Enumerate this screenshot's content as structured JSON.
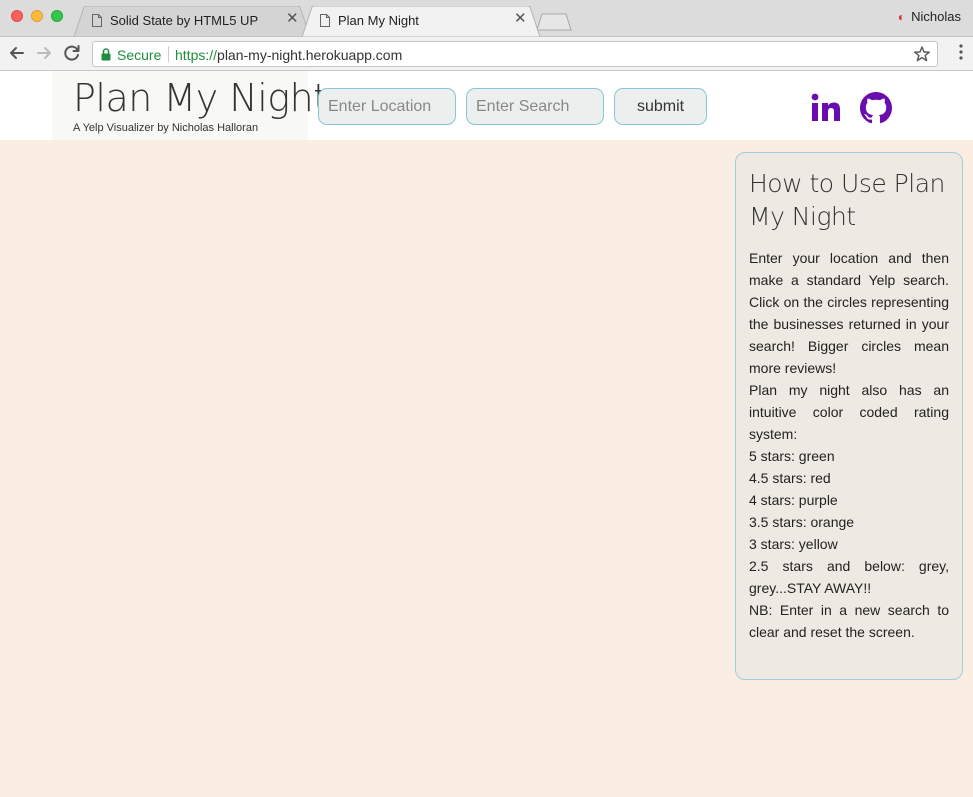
{
  "browser": {
    "tabs": [
      {
        "title": "Solid State by HTML5 UP",
        "active": false
      },
      {
        "title": "Plan My Night",
        "active": true
      }
    ],
    "profile_name": "Nicholas",
    "secure_label": "Secure",
    "url_scheme": "https://",
    "url_host": "plan-my-night.herokuapp.com"
  },
  "header": {
    "title": "Plan My Night",
    "subtitle": "A Yelp Visualizer by Nicholas Halloran",
    "location_placeholder": "Enter Location",
    "search_placeholder": "Enter Search",
    "submit_label": "submit",
    "social_icons": [
      "linkedin-icon",
      "github-icon"
    ],
    "social_color": "#6a0dad"
  },
  "info": {
    "title": "How to Use Plan My Night",
    "lines": [
      "Enter your location and then make a standard Yelp search. Click on the circles representing the businesses returned in your search! Bigger circles mean more reviews!",
      "Plan my night also has an intuitive color coded rating system:",
      "5 stars: green",
      "4.5 stars: red",
      "4 stars: purple",
      "3.5 stars: orange",
      "3 stars: yellow",
      "2.5 stars and below: grey, grey...STAY AWAY!!",
      "NB: Enter in a new search to clear and reset the screen."
    ]
  },
  "colors": {
    "page_background": "#faeee2",
    "field_border": "#86c7d6",
    "secure_green": "#1e8e3e"
  }
}
